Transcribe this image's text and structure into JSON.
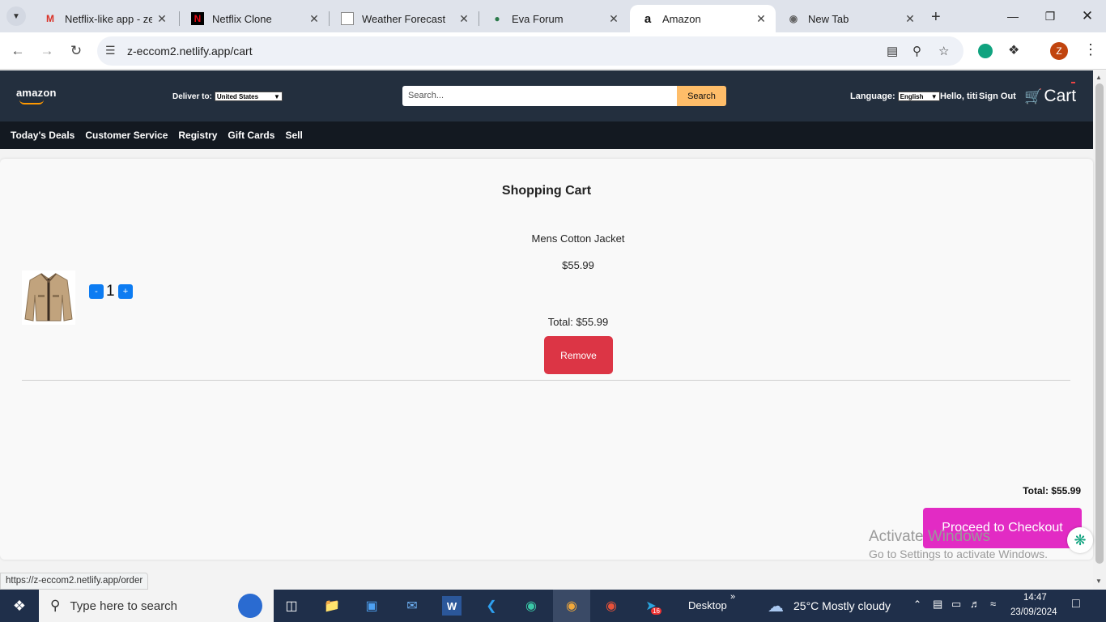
{
  "browser": {
    "tabs": [
      {
        "title": "Netflix-like app - zew",
        "favicon": "gmail-icon",
        "active": false
      },
      {
        "title": "Netflix Clone",
        "favicon": "netflix-icon",
        "active": false
      },
      {
        "title": "Weather Forecast",
        "favicon": "page-icon",
        "active": false
      },
      {
        "title": "Eva Forum",
        "favicon": "forum-icon",
        "active": false
      },
      {
        "title": "Amazon",
        "favicon": "amazon-icon",
        "active": true
      },
      {
        "title": "New Tab",
        "favicon": "chrome-icon",
        "active": false
      }
    ],
    "url": "z-eccom2.netlify.app/cart",
    "profile_initial": "Z",
    "status_url": "https://z-eccom2.netlify.app/order"
  },
  "header": {
    "logo": "amazon",
    "deliver_label": "Deliver to:",
    "deliver_value": "United States",
    "search_placeholder": "Search...",
    "search_button": "Search",
    "language_label": "Language:",
    "language_value": "English",
    "greeting": "Hello, titi",
    "sign_out": "Sign Out",
    "cart_label": "Cart"
  },
  "subnav": [
    "Today's Deals",
    "Customer Service",
    "Registry",
    "Gift Cards",
    "Sell"
  ],
  "cart": {
    "title": "Shopping Cart",
    "items": [
      {
        "name": "Mens Cotton Jacket",
        "price": "$55.99",
        "quantity": "1",
        "total": "Total: $55.99",
        "remove": "Remove"
      }
    ],
    "decrement": "-",
    "increment": "+",
    "grand_total": "Total: $55.99",
    "checkout": "Proceed to Checkout"
  },
  "watermark": {
    "line1": "Activate Windows",
    "line2": "Go to Settings to activate Windows."
  },
  "taskbar": {
    "search_placeholder": "Type here to search",
    "desktop_label": "Desktop",
    "weather": "25°C  Mostly cloudy",
    "time": "14:47",
    "date": "23/09/2024",
    "telegram_badge": "16"
  },
  "colors": {
    "header_bg": "#232f3e",
    "subnav_bg": "#131921",
    "search_btn": "#febd69",
    "remove_btn": "#dc3545",
    "checkout_btn": "#e22bc4",
    "qty_btn": "#0d7cf2"
  }
}
